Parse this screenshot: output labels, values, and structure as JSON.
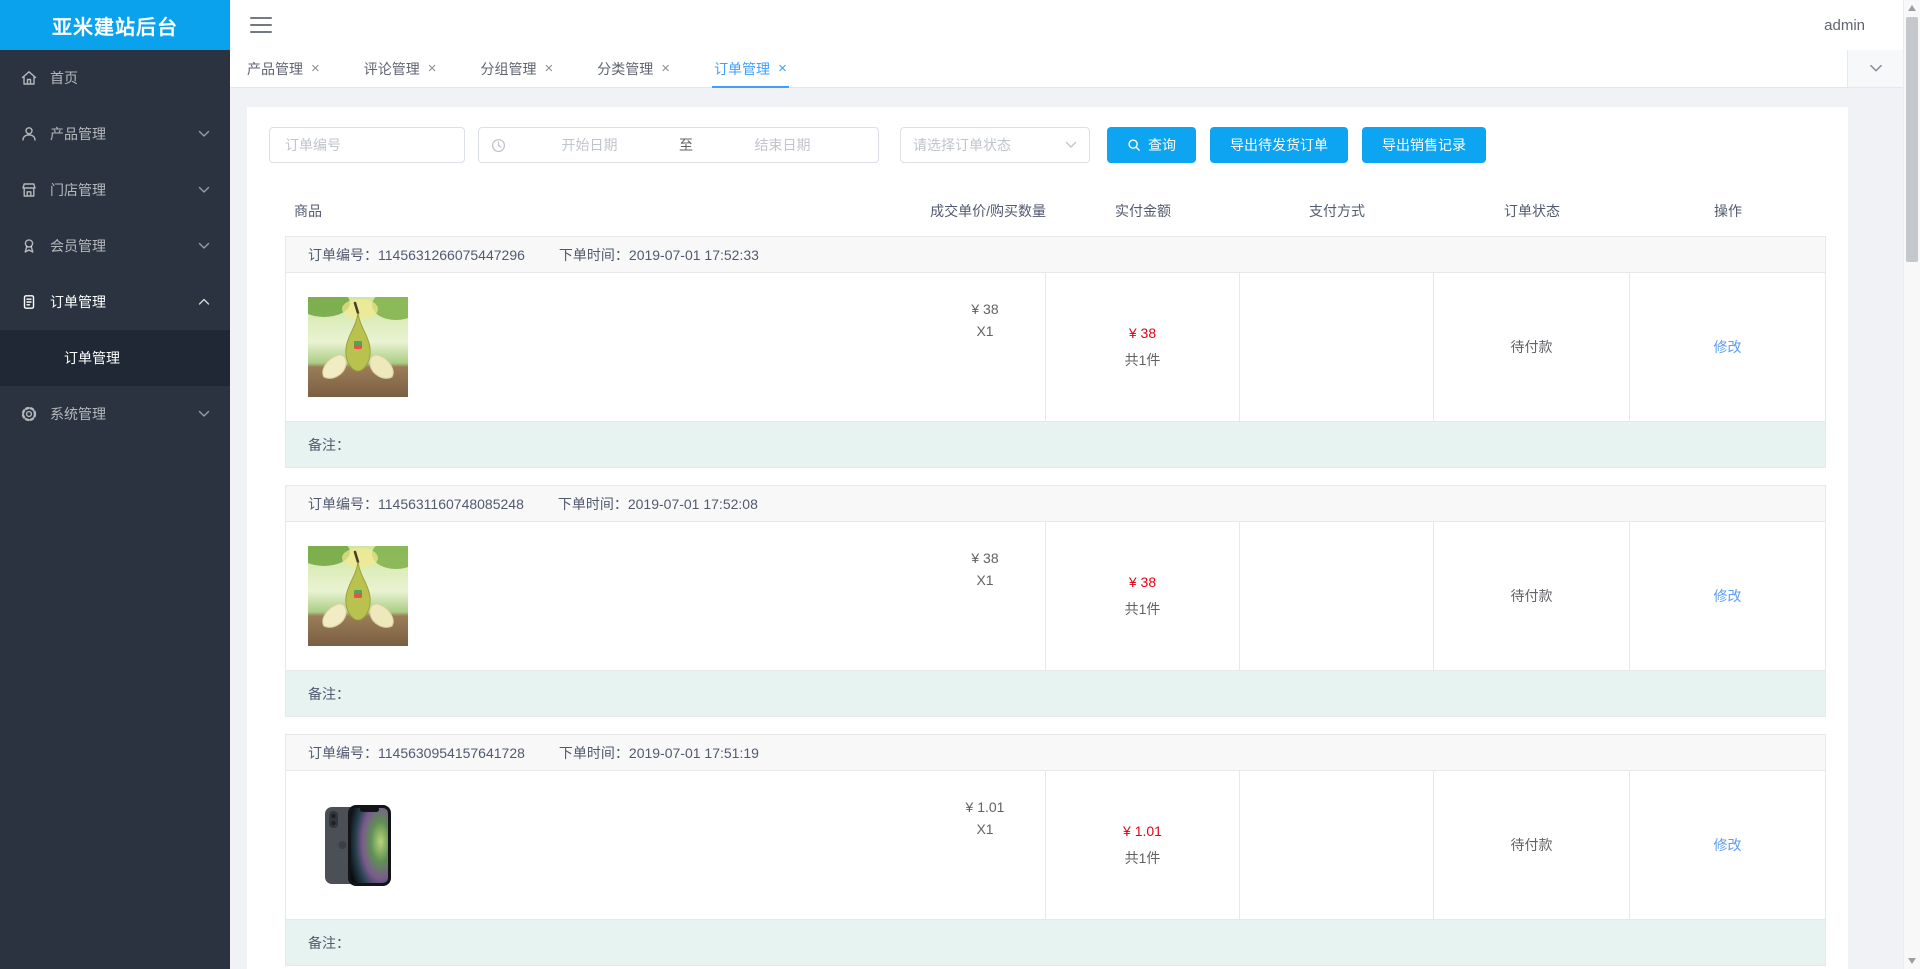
{
  "app": {
    "title": "亚米建站后台",
    "user": "admin"
  },
  "sidebar": {
    "items": [
      {
        "label": "首页",
        "icon": "home-icon"
      },
      {
        "label": "产品管理",
        "icon": "product-icon",
        "chevron": "down"
      },
      {
        "label": "门店管理",
        "icon": "store-icon",
        "chevron": "down"
      },
      {
        "label": "会员管理",
        "icon": "member-icon",
        "chevron": "down"
      },
      {
        "label": "订单管理",
        "icon": "order-icon",
        "chevron": "up",
        "active": true
      },
      {
        "label": "系统管理",
        "icon": "gear-icon",
        "chevron": "down"
      }
    ],
    "submenu": {
      "label": "订单管理",
      "active": true
    }
  },
  "tabs": [
    {
      "label": "产品管理",
      "close": "×"
    },
    {
      "label": "评论管理",
      "close": "×"
    },
    {
      "label": "分组管理",
      "close": "×"
    },
    {
      "label": "分类管理",
      "close": "×"
    },
    {
      "label": "订单管理",
      "close": "×",
      "active": true
    }
  ],
  "filters": {
    "order_no_placeholder": "订单编号",
    "date_start_placeholder": "开始日期",
    "date_separator": "至",
    "date_end_placeholder": "结束日期",
    "status_placeholder": "请选择订单状态",
    "search_label": "查询",
    "export_pending_label": "导出待发货订单",
    "export_sales_label": "导出销售记录"
  },
  "table": {
    "headers": [
      "商品",
      "成交单价/购买数量",
      "实付金额",
      "支付方式",
      "订单状态",
      "操作"
    ],
    "labels": {
      "order_no": "订单编号：",
      "order_time": "下单时间：",
      "remark": "备注："
    },
    "orders": [
      {
        "order_no": "1145631266075447296",
        "order_time": "2019-07-01 17:52:33",
        "product_image": "pear",
        "unit_price": "¥ 38",
        "quantity": "X1",
        "paid_amount": "¥ 38",
        "items_count": "共1件",
        "payment_method": "",
        "status": "待付款",
        "action": "修改",
        "remark": ""
      },
      {
        "order_no": "1145631160748085248",
        "order_time": "2019-07-01 17:52:08",
        "product_image": "pear",
        "unit_price": "¥ 38",
        "quantity": "X1",
        "paid_amount": "¥ 38",
        "items_count": "共1件",
        "payment_method": "",
        "status": "待付款",
        "action": "修改",
        "remark": ""
      },
      {
        "order_no": "1145630954157641728",
        "order_time": "2019-07-01 17:51:19",
        "product_image": "iphone",
        "unit_price": "¥ 1.01",
        "quantity": "X1",
        "paid_amount": "¥ 1.01",
        "items_count": "共1件",
        "payment_method": "",
        "status": "待付款",
        "action": "修改",
        "remark": ""
      }
    ]
  },
  "colors": {
    "primary_blue": "#0da4f2",
    "logo_blue": "#0aa2ec",
    "tab_active_blue": "#409eff",
    "price_red": "#e60012",
    "link_blue": "#5c9df5",
    "sidebar_bg": "#2a333f",
    "sidebar_submenu_bg": "#1f2834",
    "remark_bg": "#e6f3f1",
    "order_head_bg": "#f8f8f9",
    "content_bg": "#f0f2f5"
  }
}
